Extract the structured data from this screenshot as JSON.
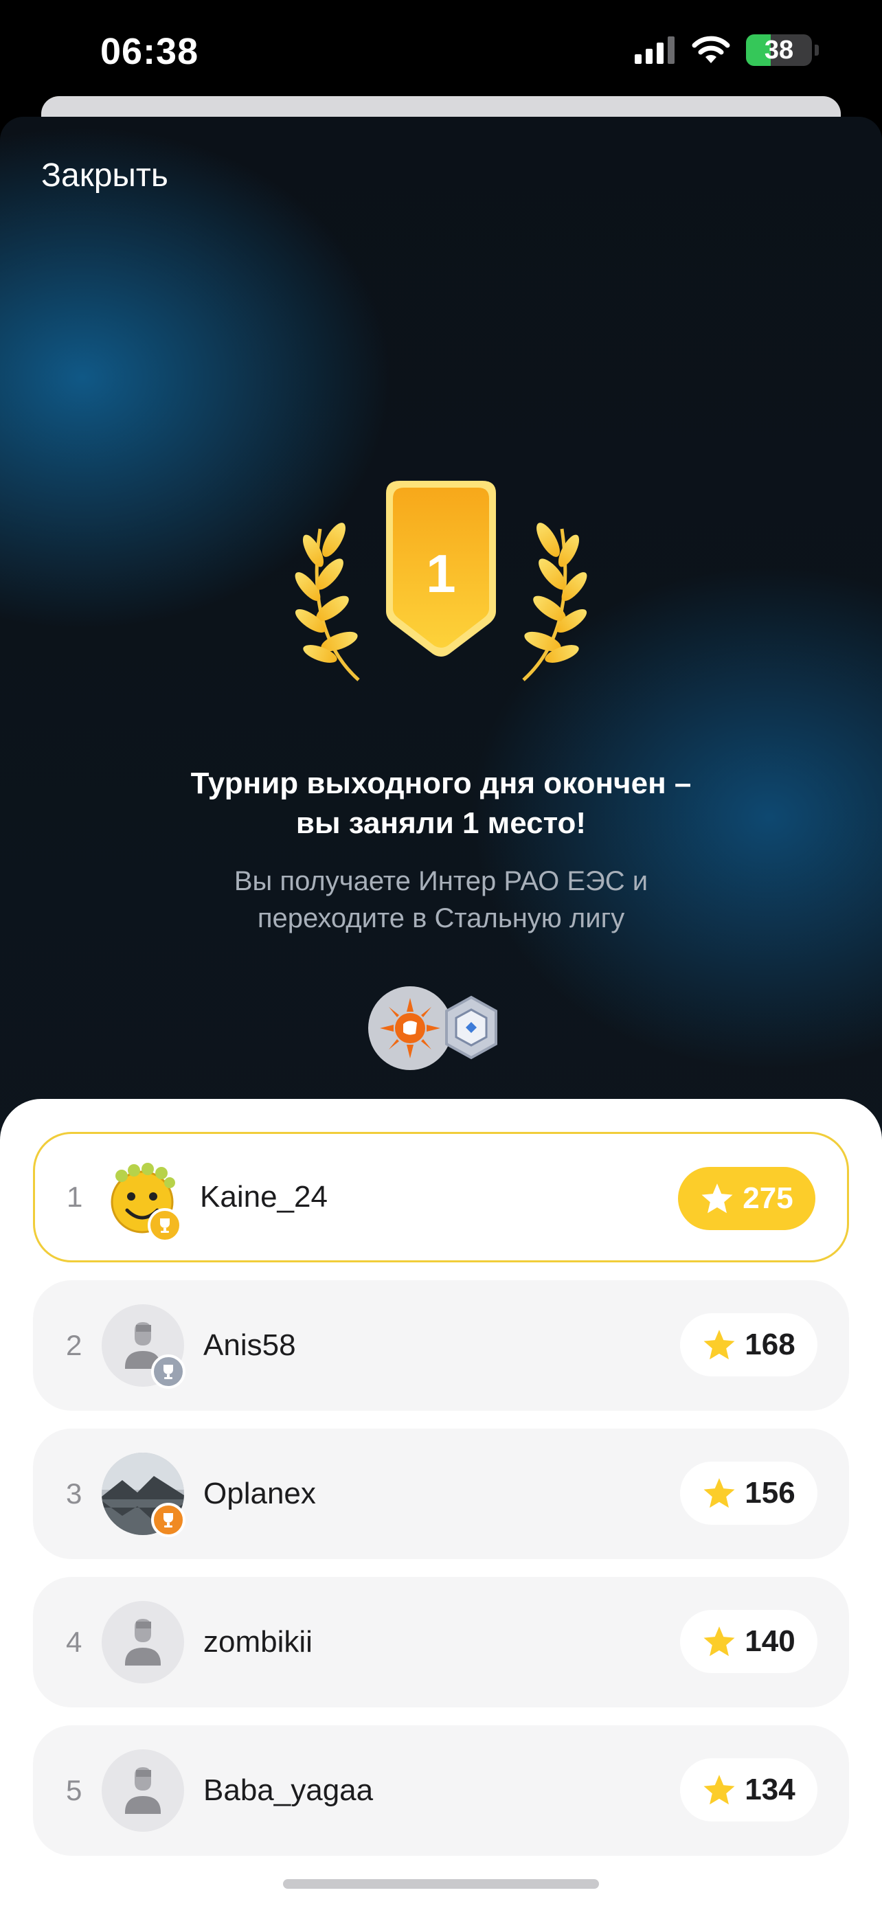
{
  "status_bar": {
    "time": "06:38",
    "battery_level": "38",
    "battery_fraction": 0.38,
    "icons": [
      "cellular-signal-icon",
      "wifi-icon",
      "battery-charging-icon"
    ]
  },
  "header": {
    "close_label": "Закрыть"
  },
  "award": {
    "place": "1",
    "icons": [
      "laurel-left-icon",
      "rank-shield-icon",
      "laurel-right-icon"
    ]
  },
  "message": {
    "title_line1": "Турнир выходного дня окончен –",
    "title_line2": "вы заняли 1 место!",
    "subtitle_line1": "Вы получаете Интер РАО ЕЭС и",
    "subtitle_line2": "переходите в Стальную лигу"
  },
  "rewards": {
    "icons": [
      "inter-rao-logo-icon",
      "steel-league-badge-icon"
    ]
  },
  "leaderboard": {
    "rows": [
      {
        "rank": "1",
        "name": "Kaine_24",
        "score": "275",
        "avatar": "smiley-avatar",
        "badge": "gold"
      },
      {
        "rank": "2",
        "name": "Anis58",
        "score": "168",
        "avatar": "default-avatar",
        "badge": "silver"
      },
      {
        "rank": "3",
        "name": "Oplanex",
        "score": "156",
        "avatar": "landscape-avatar",
        "badge": "bronze"
      },
      {
        "rank": "4",
        "name": "zombikii",
        "score": "140",
        "avatar": "default-avatar",
        "badge": ""
      },
      {
        "rank": "5",
        "name": "Baba_yagaa",
        "score": "134",
        "avatar": "default-avatar",
        "badge": ""
      }
    ]
  },
  "colors": {
    "accent_gold": "#FCCD2A",
    "badge_gold": "#F5B920",
    "badge_silver": "#9AA3B2",
    "badge_bronze": "#F08A22",
    "highlight_border": "#F1CD3A"
  }
}
